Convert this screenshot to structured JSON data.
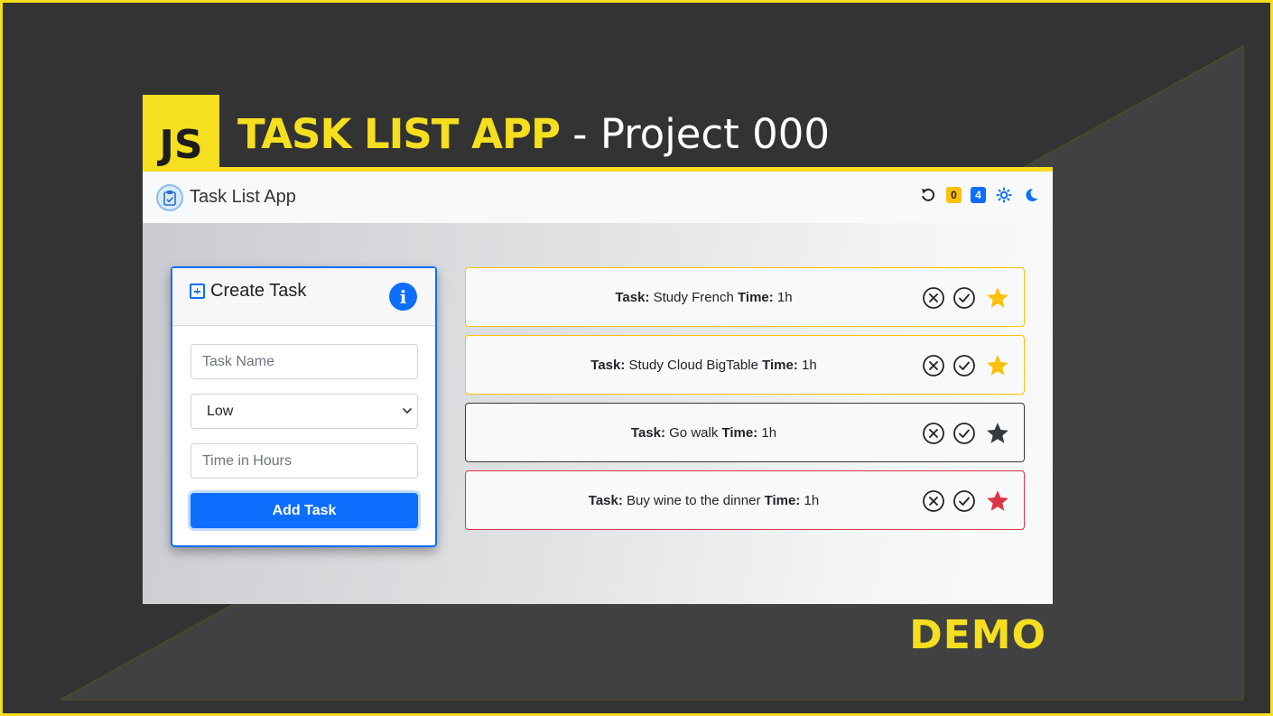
{
  "banner": {
    "logo_text": "JS",
    "title_strong": "TASK LIST APP",
    "title_rest": " - Project 000",
    "demo_label": "DEMO",
    "accent_color": "#f5df1e"
  },
  "navbar": {
    "brand": "Task List App",
    "brand_icon": "clipboard-check-icon",
    "undo_icon": "undo-icon",
    "badge_warning": "0",
    "badge_info": "4",
    "light_theme_icon": "sun-icon",
    "dark_theme_icon": "moon-icon"
  },
  "form": {
    "title": "Create Task",
    "info_label": "i",
    "task_name_placeholder": "Task Name",
    "priority_selected": "Low",
    "time_placeholder": "Time in Hours",
    "submit_label": "Add Task",
    "primary_color": "#0d6efd"
  },
  "tasks": [
    {
      "task_label": "Task:",
      "name": "Study French",
      "time_label": "Time:",
      "time": "1h",
      "priority_color": "#ffc107"
    },
    {
      "task_label": "Task:",
      "name": "Study Cloud BigTable",
      "time_label": "Time:",
      "time": "1h",
      "priority_color": "#ffc107"
    },
    {
      "task_label": "Task:",
      "name": "Go walk",
      "time_label": "Time:",
      "time": "1h",
      "priority_color": "#343a40"
    },
    {
      "task_label": "Task:",
      "name": "Buy wine to the dinner",
      "time_label": "Time:",
      "time": "1h",
      "priority_color": "#dc3545"
    }
  ]
}
